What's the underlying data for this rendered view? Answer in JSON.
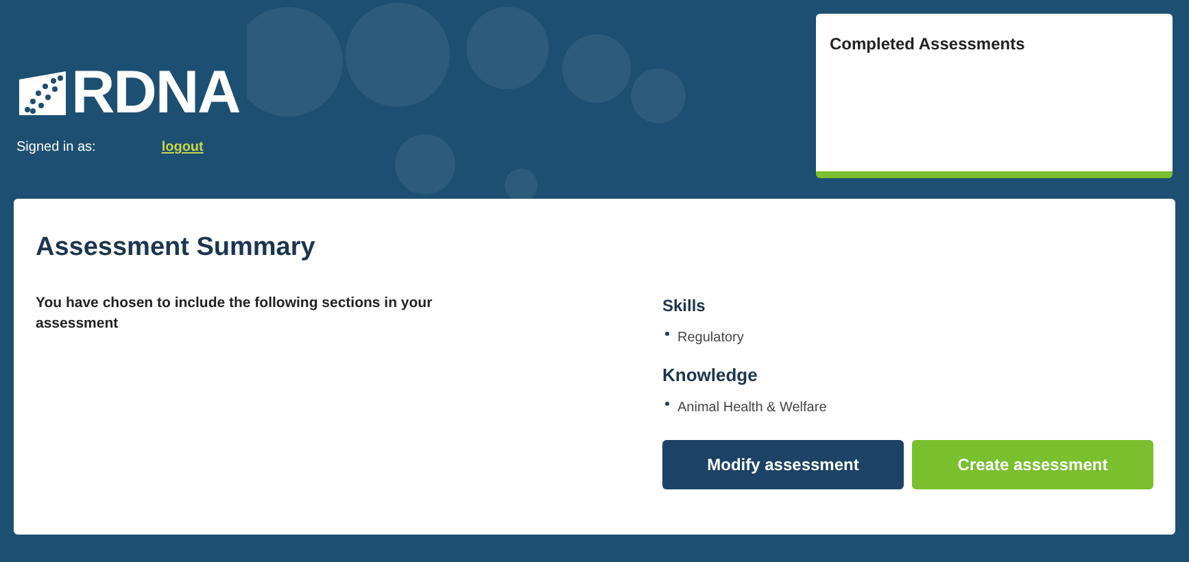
{
  "header": {
    "logo_text": "RDNA",
    "signed_in_label": "Signed in as:",
    "logout_link": "logout"
  },
  "completed_panel": {
    "title": "Completed Assessments"
  },
  "summary": {
    "title": "Assessment Summary",
    "intro": "You have chosen to include the following sections in your assessment",
    "sections": [
      {
        "heading": "Skills",
        "items": [
          "Regulatory"
        ]
      },
      {
        "heading": "Knowledge",
        "items": [
          "Animal Health & Welfare"
        ]
      }
    ],
    "buttons": [
      {
        "label": "Modify assessment",
        "kind": "secondary"
      },
      {
        "label": "Create assessment",
        "kind": "primary"
      }
    ]
  }
}
